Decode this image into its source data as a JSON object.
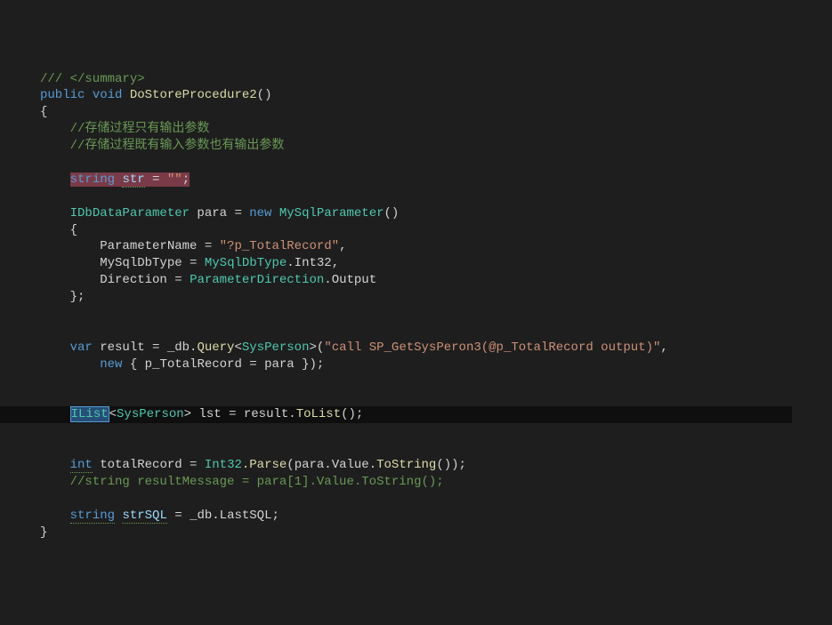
{
  "code": {
    "l1_comment": "/// </summary>",
    "l2_public": "public",
    "l2_void": "void",
    "l2_method": "DoStoreProcedure2",
    "l2_parens": "()",
    "l3_brace": "{",
    "l4_comment": "//存储过程只有输出参数",
    "l5_comment": "//存储过程既有输入参数也有输出参数",
    "l7_string": "string",
    "l7_str": "str",
    "l7_eq": " = ",
    "l7_val": "\"\"",
    "l7_semi": ";",
    "l9_type": "IDbDataParameter",
    "l9_para": " para = ",
    "l9_new": "new",
    "l9_mysql": "MySqlParameter",
    "l9_parens": "()",
    "l10_brace": "{",
    "l11_prop": "ParameterName",
    "l11_eq": " = ",
    "l11_val": "\"?p_TotalRecord\"",
    "l11_comma": ",",
    "l12_prop": "MySqlDbType",
    "l12_eq": " = ",
    "l12_enum": "MySqlDbType",
    "l12_dot": ".Int32,",
    "l13_prop": "Direction",
    "l13_eq": " = ",
    "l13_enum": "ParameterDirection",
    "l13_dot": ".Output",
    "l14_brace": "};",
    "l17_var": "var",
    "l17_result": " result = _db.",
    "l17_query": "Query",
    "l17_lt": "<",
    "l17_sysperson": "SysPerson",
    "l17_gt": ">(",
    "l17_str": "\"call SP_GetSysPeron3(@p_TotalRecord output)\"",
    "l17_comma": ",",
    "l18_new": "new",
    "l18_obj": " { p_TotalRecord = para });",
    "l21_ilist": "IList",
    "l21_lt": "<",
    "l21_sysperson": "SysPerson",
    "l21_gt": "> lst = result.",
    "l21_tolist": "ToList",
    "l21_parens": "();",
    "l23_int": "int",
    "l23_tr": " totalRecord = ",
    "l23_int32": "Int32",
    "l23_parse": ".Parse",
    "l23_para": "(para.Value.",
    "l23_tostring": "ToString",
    "l23_end": "());",
    "l24_comment": "//string resultMessage = para[1].Value.ToString();",
    "l26_string": "string",
    "l26_strsql": "strSQL",
    "l26_rest": " = _db.LastSQL;",
    "l27_brace": "}"
  }
}
